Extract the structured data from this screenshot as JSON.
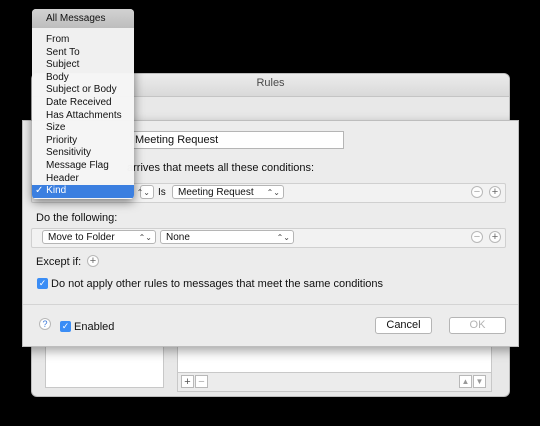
{
  "rules_window": {
    "title": "Rules",
    "list_add_label": "+",
    "list_remove_label": "−",
    "scroll_up_label": "▲",
    "scroll_down_label": "▼"
  },
  "rule_sheet": {
    "rule_name": "Meeting Request",
    "condition_intro": "arrives that meets all these conditions:",
    "condition": {
      "field": "Kind",
      "operator": "Is",
      "value": "Meeting Request"
    },
    "do_following_label": "Do the following:",
    "action": {
      "type": "Move to Folder",
      "target": "None"
    },
    "except_if_label": "Except if:",
    "no_other_rules_label": "Do not apply other rules to messages that meet the same conditions",
    "no_other_rules_checked": true,
    "help_label": "?",
    "enabled_label": "Enabled",
    "enabled_checked": true,
    "cancel_label": "Cancel",
    "ok_label": "OK",
    "remove_label": "−",
    "add_label": "+"
  },
  "field_menu": {
    "header": "All Messages",
    "items": [
      "From",
      "Sent To",
      "Subject",
      "Body",
      "Subject or Body",
      "Date Received",
      "Has Attachments",
      "Size",
      "Priority",
      "Sensitivity",
      "Message Flag",
      "Header",
      "Kind"
    ],
    "selected": "Kind",
    "checkmark": "✓"
  },
  "colors": {
    "accent": "#3b7fe0",
    "checkbox": "#3b8df5"
  }
}
